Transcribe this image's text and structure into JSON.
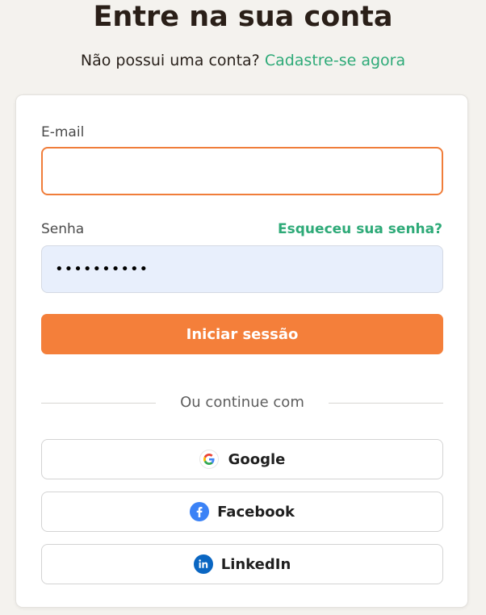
{
  "header": {
    "title": "Entre na sua conta",
    "signup_prompt": "Não possui uma conta?",
    "signup_link": "Cadastre-se agora"
  },
  "form": {
    "email_label": "E-mail",
    "email_value": "",
    "password_label": "Senha",
    "forgot_link": "Esqueceu sua senha?",
    "password_value": "••••••••••",
    "submit_label": "Iniciar sessão"
  },
  "divider": {
    "text": "Ou continue com"
  },
  "social": {
    "google_label": "Google",
    "facebook_label": "Facebook",
    "linkedin_label": "LinkedIn",
    "google_icon": "google-icon",
    "facebook_icon": "facebook-icon",
    "linkedin_icon": "linkedin-icon"
  },
  "colors": {
    "accent_orange": "#f47f3a",
    "link_green": "#2eaa78",
    "facebook_blue": "#3b82f6",
    "linkedin_blue": "#0a66c2",
    "page_background": "#f4f2ee"
  }
}
